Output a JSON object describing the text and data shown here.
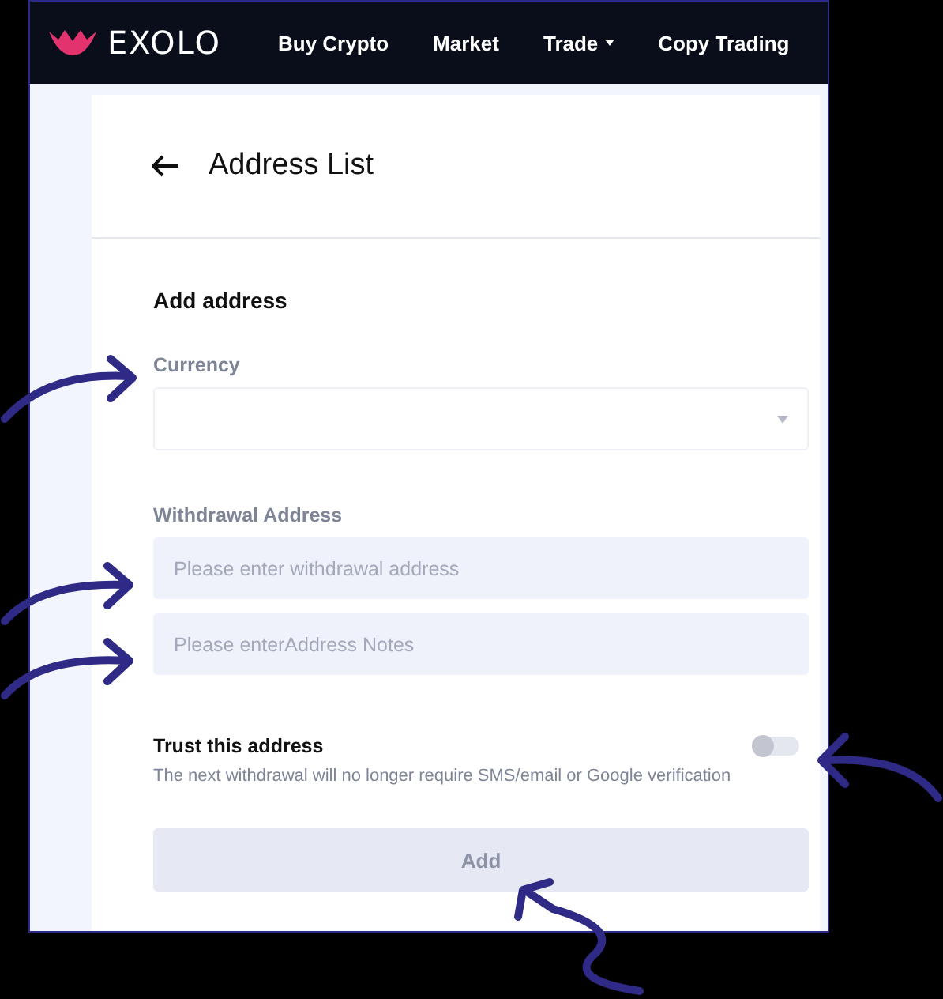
{
  "brand": {
    "name": "EXOLO"
  },
  "nav": [
    {
      "label": "Buy Crypto",
      "has_menu": false
    },
    {
      "label": "Market",
      "has_menu": false
    },
    {
      "label": "Trade",
      "has_menu": true
    },
    {
      "label": "Copy Trading",
      "has_menu": false
    }
  ],
  "page": {
    "title": "Address List"
  },
  "form": {
    "heading": "Add address",
    "fields": [
      {
        "kind": "select",
        "label": "Currency"
      },
      {
        "kind": "input",
        "label": "Withdrawal Address",
        "placeholder": "Please enter withdrawal address"
      },
      {
        "kind": "input",
        "placeholder": "Please enterAddress Notes"
      }
    ],
    "trust": {
      "label": "Trust this address",
      "on": false,
      "note": "The next withdrawal will no longer require SMS/email or Google verification"
    },
    "submit": {
      "label": "Add",
      "disabled": true
    }
  }
}
